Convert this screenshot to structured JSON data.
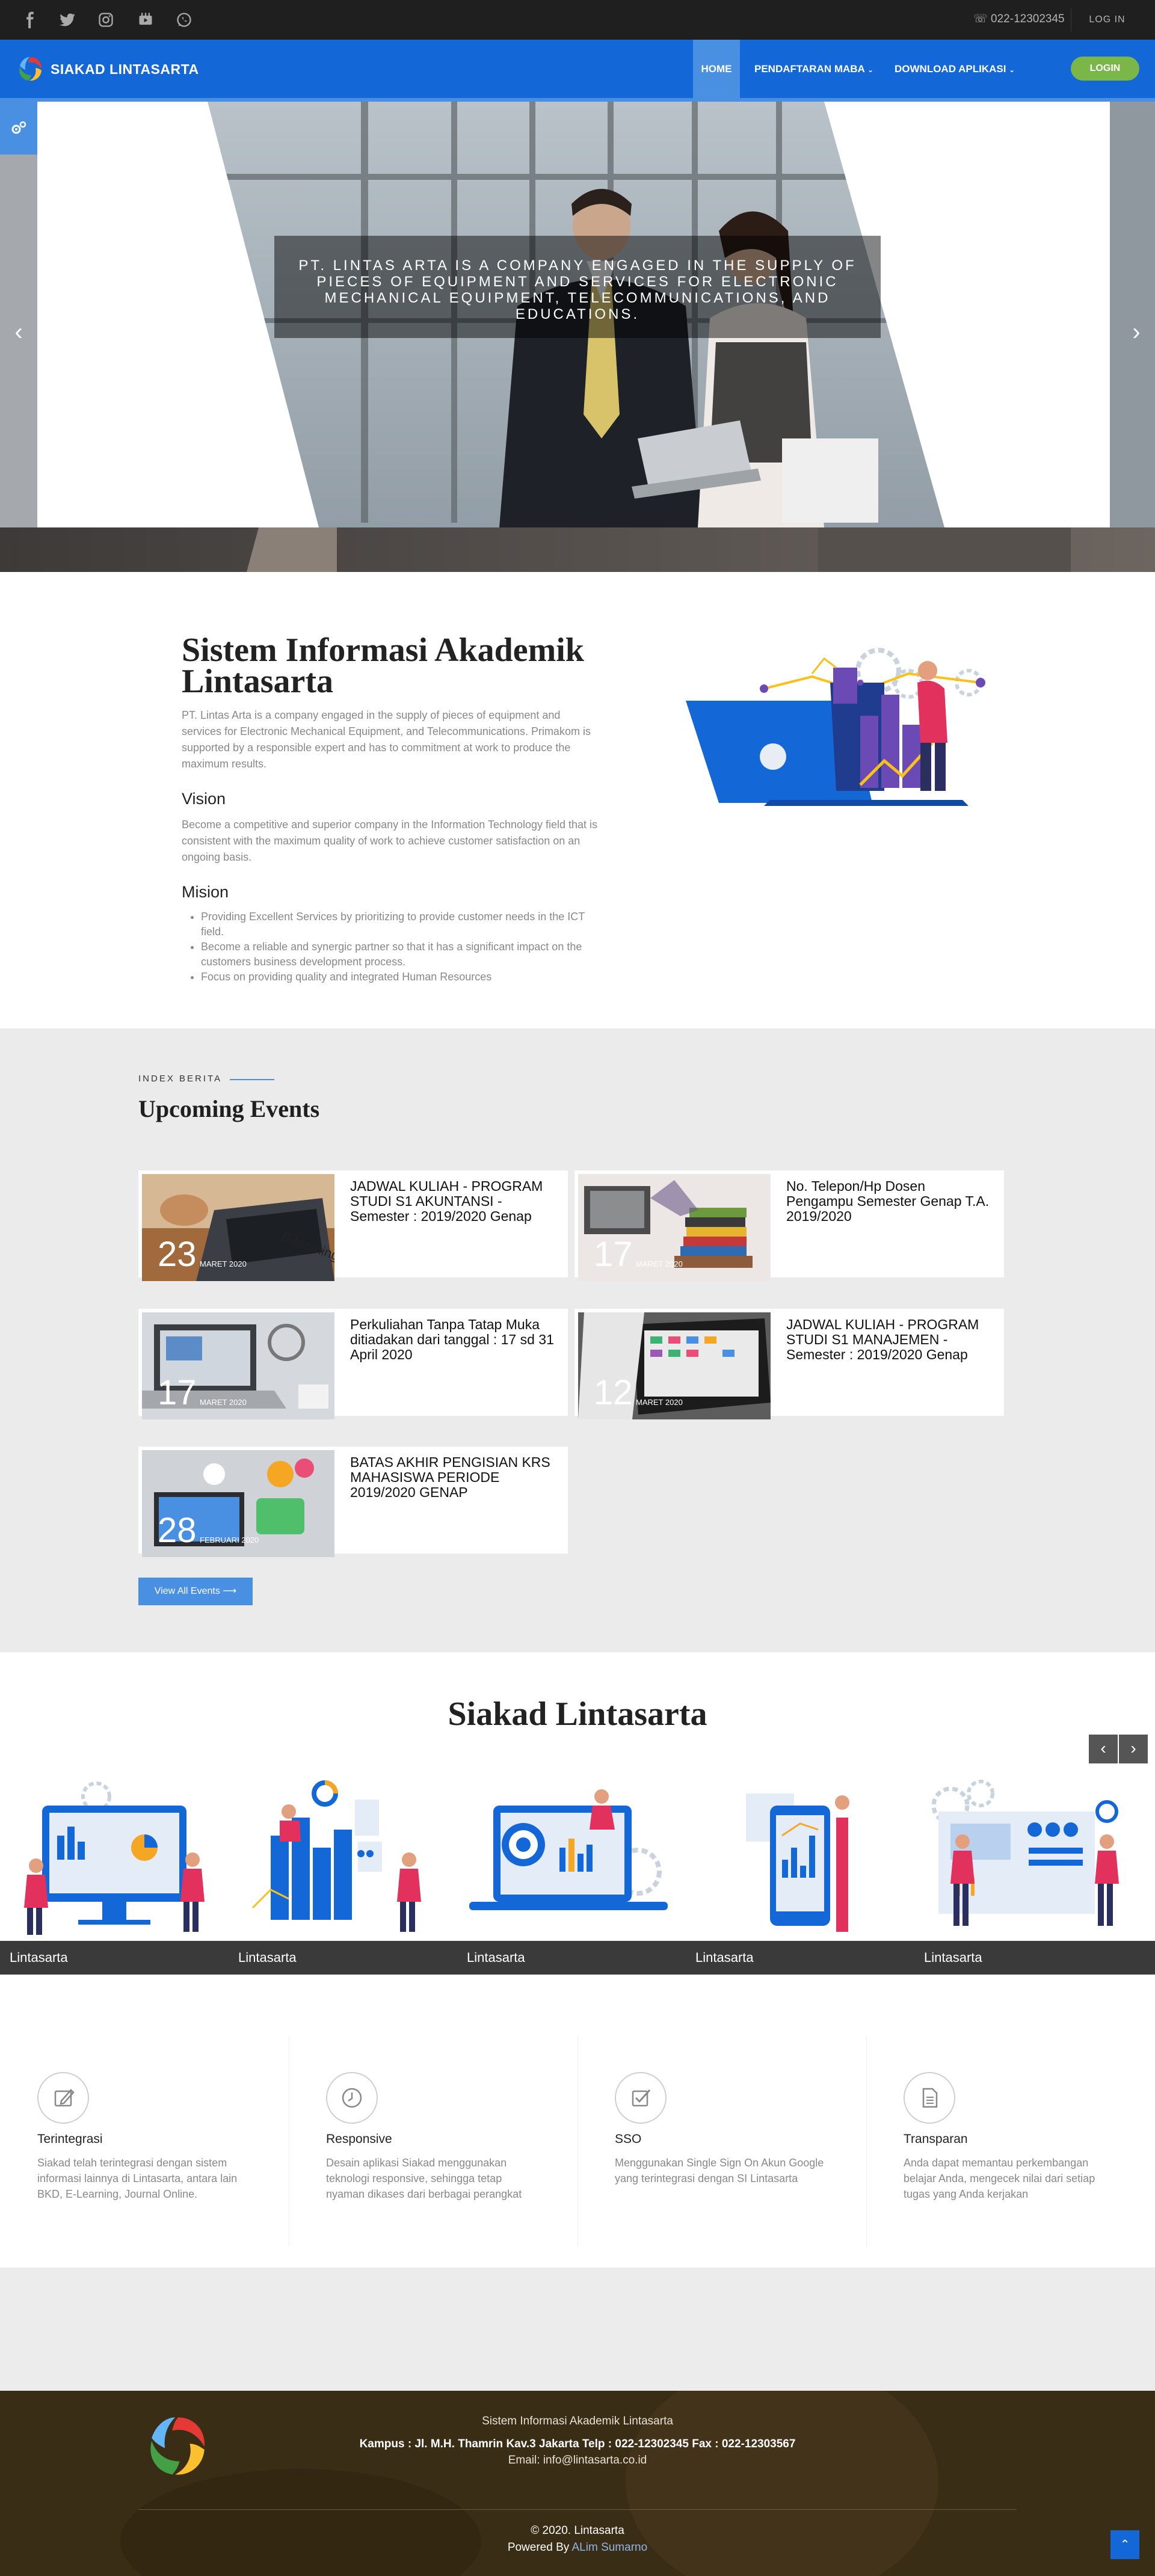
{
  "topbar": {
    "social_icons": [
      "facebook-icon",
      "twitter-icon",
      "instagram-icon",
      "youtube-icon",
      "whatsapp-icon"
    ],
    "phone": "022-12302345",
    "login_label": "LOG IN"
  },
  "navbar": {
    "brand": "SIAKAD LINTASARTA",
    "home": "HOME",
    "pendaftaran": "PENDAFTARAN MABA",
    "download": "DOWNLOAD APLIKASI",
    "login": "LOGIN"
  },
  "hero": {
    "caption": "PT. LINTAS ARTA IS A COMPANY ENGAGED IN THE SUPPLY OF PIECES OF EQUIPMENT AND SERVICES FOR ELECTRONIC MECHANICAL EQUIPMENT, TELECOMMUNICATIONS, AND EDUCATIONS."
  },
  "about": {
    "title": "Sistem Informasi Akademik Lintasarta",
    "desc": "PT. Lintas Arta is a company engaged in the supply of pieces of equipment and services for Electronic Mechanical Equipment, and Telecommunications. Primakom is supported by a responsible expert and has to commitment at work to produce the maximum results.",
    "vision_title": "Vision",
    "vision_text": "Become a competitive and superior company in the Information Technology field that is consistent with the maximum quality of work to achieve customer satisfaction on an ongoing basis.",
    "mission_title": "Mision",
    "missions": [
      "Providing Excellent Services by prioritizing to provide customer needs in the ICT field.",
      "Become a reliable and synergic partner so that it has a significant impact on the customers business development process.",
      "Focus on providing quality and integrated Human Resources"
    ]
  },
  "events": {
    "kicker": "INDEX BERITA",
    "title": "Upcoming Events",
    "items": [
      {
        "day": "23",
        "month": "MARET 2020",
        "title": "JADWAL KULIAH - PROGRAM STUDI S1 AKUNTANSI - Semester : 2019/2020 Genap"
      },
      {
        "day": "17",
        "month": "MARET 2020",
        "title": "No. Telepon/Hp Dosen Pengampu Semester Genap T.A. 2019/2020"
      },
      {
        "day": "17",
        "month": "MARET 2020",
        "title": "Perkuliahan Tanpa Tatap Muka ditiadakan dari tanggal : 17 sd 31 April 2020"
      },
      {
        "day": "12",
        "month": "MARET 2020",
        "title": "JADWAL KULIAH - PROGRAM STUDI S1 MANAJEMEN - Semester : 2019/2020 Genap"
      },
      {
        "day": "28",
        "month": "FEBRUARI 2020",
        "title": "BATAS AKHIR PENGISIAN KRS MAHASISWA PERIODE 2019/2020 GENAP"
      }
    ],
    "view_all": "View All Events ⟶"
  },
  "siakad": {
    "title": "Siakad Lintasarta",
    "slides": [
      "Lintasarta",
      "Lintasarta",
      "Lintasarta",
      "Lintasarta",
      "Lintasarta"
    ]
  },
  "features": [
    {
      "icon": "edit-icon",
      "title": "Terintegrasi",
      "desc": "Siakad telah terintegrasi dengan sistem informasi lainnya di Lintasarta, antara lain BKD, E-Learning, Journal Online."
    },
    {
      "icon": "clock-icon",
      "title": "Responsive",
      "desc": "Desain aplikasi Siakad menggunakan teknologi responsive, sehingga tetap nyaman dikases dari berbagai perangkat"
    },
    {
      "icon": "checkbox-icon",
      "title": "SSO",
      "desc": "Menggunakan Single Sign On Akun Google yang terintegrasi dengan SI Lintasarta"
    },
    {
      "icon": "document-icon",
      "title": "Transparan",
      "desc": "Anda dapat memantau perkembangan belajar Anda, mengecek nilai dari setiap tugas yang Anda kerjakan"
    }
  ],
  "footer": {
    "org": "Sistem Informasi Akademik Lintasarta",
    "address": "Kampus : Jl. M.H. Thamrin Kav.3 Jakarta Telp : 022-12302345 Fax : 022-12303567",
    "email_label": "Email:",
    "email": "info@lintasarta.co.id",
    "copyright": "© 2020. Lintasarta",
    "powered_label": "Powered By",
    "powered_by": "ALim Sumarno"
  },
  "colors": {
    "primary": "#1467d6",
    "accent": "#4a90e2",
    "login_green": "#7ab648",
    "footer_bg": "#3a2d15"
  }
}
